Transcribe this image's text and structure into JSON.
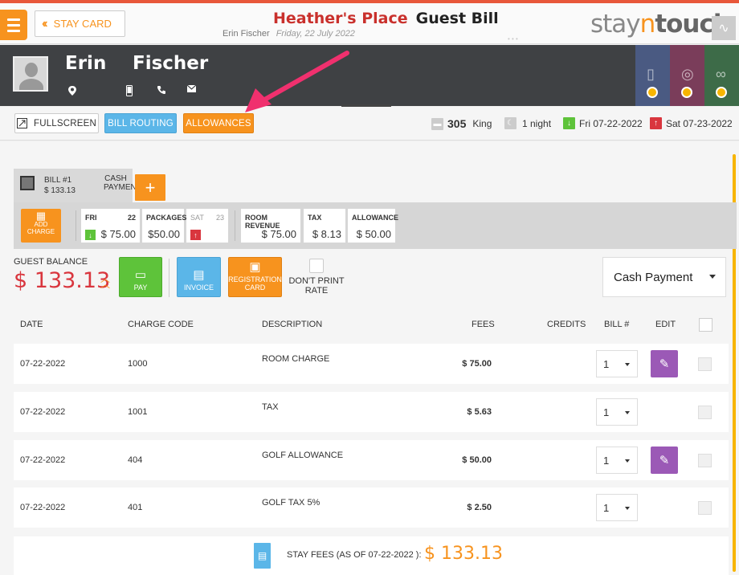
{
  "header": {
    "hotel_name": "Heather's Place",
    "bill_title": "Guest Bill",
    "guest_name": "Erin Fischer",
    "date": "Friday, 22 July 2022",
    "stay_card_label": "STAY CARD",
    "logo": {
      "pre": "stay",
      "n": "n",
      "tail": "touch"
    }
  },
  "guest": {
    "first_name": "Erin",
    "last_name": "Fischer",
    "icons": [
      "location-icon",
      "mobile-icon",
      "phone-icon",
      "email-icon"
    ]
  },
  "actions": {
    "fullscreen": "FULLSCREEN",
    "bill_routing": "BILL ROUTING",
    "allowances": "ALLOWANCES"
  },
  "stay": {
    "room_number": "305",
    "room_type": "King",
    "nights": "1 night",
    "arrival": "Fri 07-22-2022",
    "departure": "Sat 07-23-2022"
  },
  "bill_tab": {
    "bill_no": "BILL #1",
    "amount": "$ 133.13",
    "payment_label": "CASH PAYMENT",
    "add": "+"
  },
  "calendar": {
    "add_charge": "ADD CHARGE",
    "day1": {
      "dow": "FRI",
      "dom": "22",
      "value": "$ 75.00"
    },
    "packages": {
      "title": "PACKAGES",
      "value": "$50.00"
    },
    "day2": {
      "dow": "SAT",
      "dom": "23"
    },
    "room_revenue": {
      "title": "ROOM REVENUE",
      "value": "$ 75.00"
    },
    "tax": {
      "title": "TAX",
      "value": "$ 8.13"
    },
    "allowance": {
      "title": "ALLOWANCE",
      "value": "$ 50.00"
    }
  },
  "balance": {
    "label": "GUEST BALANCE",
    "amount": "$ 133.13",
    "pay": "PAY",
    "invoice": "INVOICE",
    "registration_card": "REGISTRATION CARD",
    "dont_print_rate": "DON'T PRINT RATE",
    "payment_method": "Cash Payment"
  },
  "table": {
    "headers": [
      "DATE",
      "CHARGE CODE",
      "DESCRIPTION",
      "FEES",
      "CREDITS",
      "BILL #",
      "EDIT"
    ],
    "rows": [
      {
        "date": "07-22-2022",
        "code": "1000",
        "description": "ROOM CHARGE",
        "fee": "$ 75.00",
        "bill": "1",
        "editable": true
      },
      {
        "date": "07-22-2022",
        "code": "1001",
        "description": "TAX",
        "fee": "$ 5.63",
        "bill": "1",
        "editable": false
      },
      {
        "date": "07-22-2022",
        "code": "404",
        "description": "GOLF ALLOWANCE",
        "fee": "$ 50.00",
        "bill": "1",
        "editable": true
      },
      {
        "date": "07-22-2022",
        "code": "401",
        "description": "GOLF TAX 5%",
        "fee": "$ 2.50",
        "bill": "1",
        "editable": false
      }
    ]
  },
  "footer": {
    "label": "STAY FEES (AS OF  07-22-2022 ):",
    "value": "$ 133.13"
  },
  "colors": {
    "accent_orange": "#f7931e",
    "brand_red": "#c9302c",
    "pay_green": "#5ec33a",
    "info_blue": "#5bb6e8",
    "edit_purple": "#9b59b6",
    "annotation_pink": "#f0306e"
  }
}
